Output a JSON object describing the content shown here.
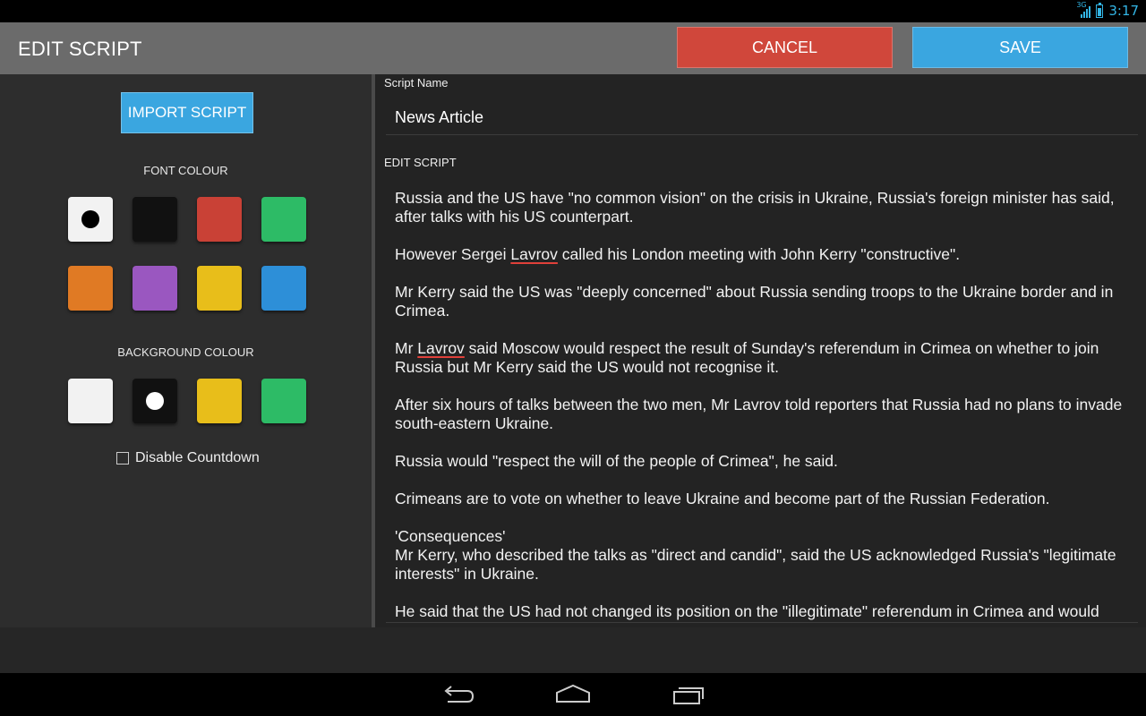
{
  "status_bar": {
    "network": "3G",
    "time": "3:17",
    "accent": "#33b5e5"
  },
  "header": {
    "title": "EDIT SCRIPT",
    "cancel_label": "CANCEL",
    "save_label": "SAVE"
  },
  "left_panel": {
    "import_label": "IMPORT SCRIPT",
    "font_colour_label": "FONT COLOUR",
    "font_colours": [
      {
        "name": "white",
        "hex": "#f2f2f2",
        "selected": true
      },
      {
        "name": "black",
        "hex": "#111111",
        "selected": false
      },
      {
        "name": "red",
        "hex": "#c94136",
        "selected": false
      },
      {
        "name": "green",
        "hex": "#2dbb66",
        "selected": false
      },
      {
        "name": "orange",
        "hex": "#e07a24",
        "selected": false
      },
      {
        "name": "purple",
        "hex": "#9a57c0",
        "selected": false
      },
      {
        "name": "yellow",
        "hex": "#e8be1a",
        "selected": false
      },
      {
        "name": "blue",
        "hex": "#2d8fd8",
        "selected": false
      }
    ],
    "background_colour_label": "BACKGROUND COLOUR",
    "background_colours": [
      {
        "name": "white",
        "hex": "#f2f2f2",
        "selected": false
      },
      {
        "name": "black",
        "hex": "#111111",
        "selected": true
      },
      {
        "name": "yellow",
        "hex": "#e8be1a",
        "selected": false
      },
      {
        "name": "green",
        "hex": "#2dbb66",
        "selected": false
      }
    ],
    "disable_countdown_label": "Disable Countdown",
    "disable_countdown_checked": false
  },
  "editor": {
    "script_name_label": "Script Name",
    "script_name_value": "News Article",
    "edit_script_label": "EDIT SCRIPT",
    "paragraphs": [
      [
        {
          "t": "Russia and the US have \"no common vision\" on the crisis in Ukraine, Russia's foreign minister has said, after talks with his US counterpart."
        }
      ],
      [
        {
          "t": "However Sergei "
        },
        {
          "t": "Lavrov",
          "spell": true
        },
        {
          "t": " called his London meeting with John Kerry \"constructive\"."
        }
      ],
      [
        {
          "t": "Mr Kerry said the US was \"deeply concerned\" about Russia sending troops to the Ukraine border and in Crimea."
        }
      ],
      [
        {
          "t": "Mr "
        },
        {
          "t": "Lavrov",
          "spell": true
        },
        {
          "t": " said Moscow would respect the result of Sunday's referendum in Crimea on whether to join Russia but Mr Kerry said the US would not recognise it."
        }
      ],
      [
        {
          "t": "After six hours of talks between the two men, Mr Lavrov told reporters that Russia had no plans to invade south-eastern Ukraine."
        }
      ],
      [
        {
          "t": "Russia would \"respect the will of the people of Crimea\", he said."
        }
      ],
      [
        {
          "t": "Crimeans are to vote on whether to leave Ukraine and become part of the Russian Federation."
        }
      ],
      [
        {
          "t": "'Consequences'\nMr Kerry, who described the talks as \"direct and candid\", said the US acknowledged Russia's \"legitimate interests\" in Ukraine."
        }
      ],
      [
        {
          "t": "He said that the US had not changed its position on the \"illegitimate\" referendum in Crimea and would"
        }
      ]
    ]
  },
  "nav_bar": {
    "buttons": [
      "back-icon",
      "home-icon",
      "recent-apps-icon"
    ]
  }
}
